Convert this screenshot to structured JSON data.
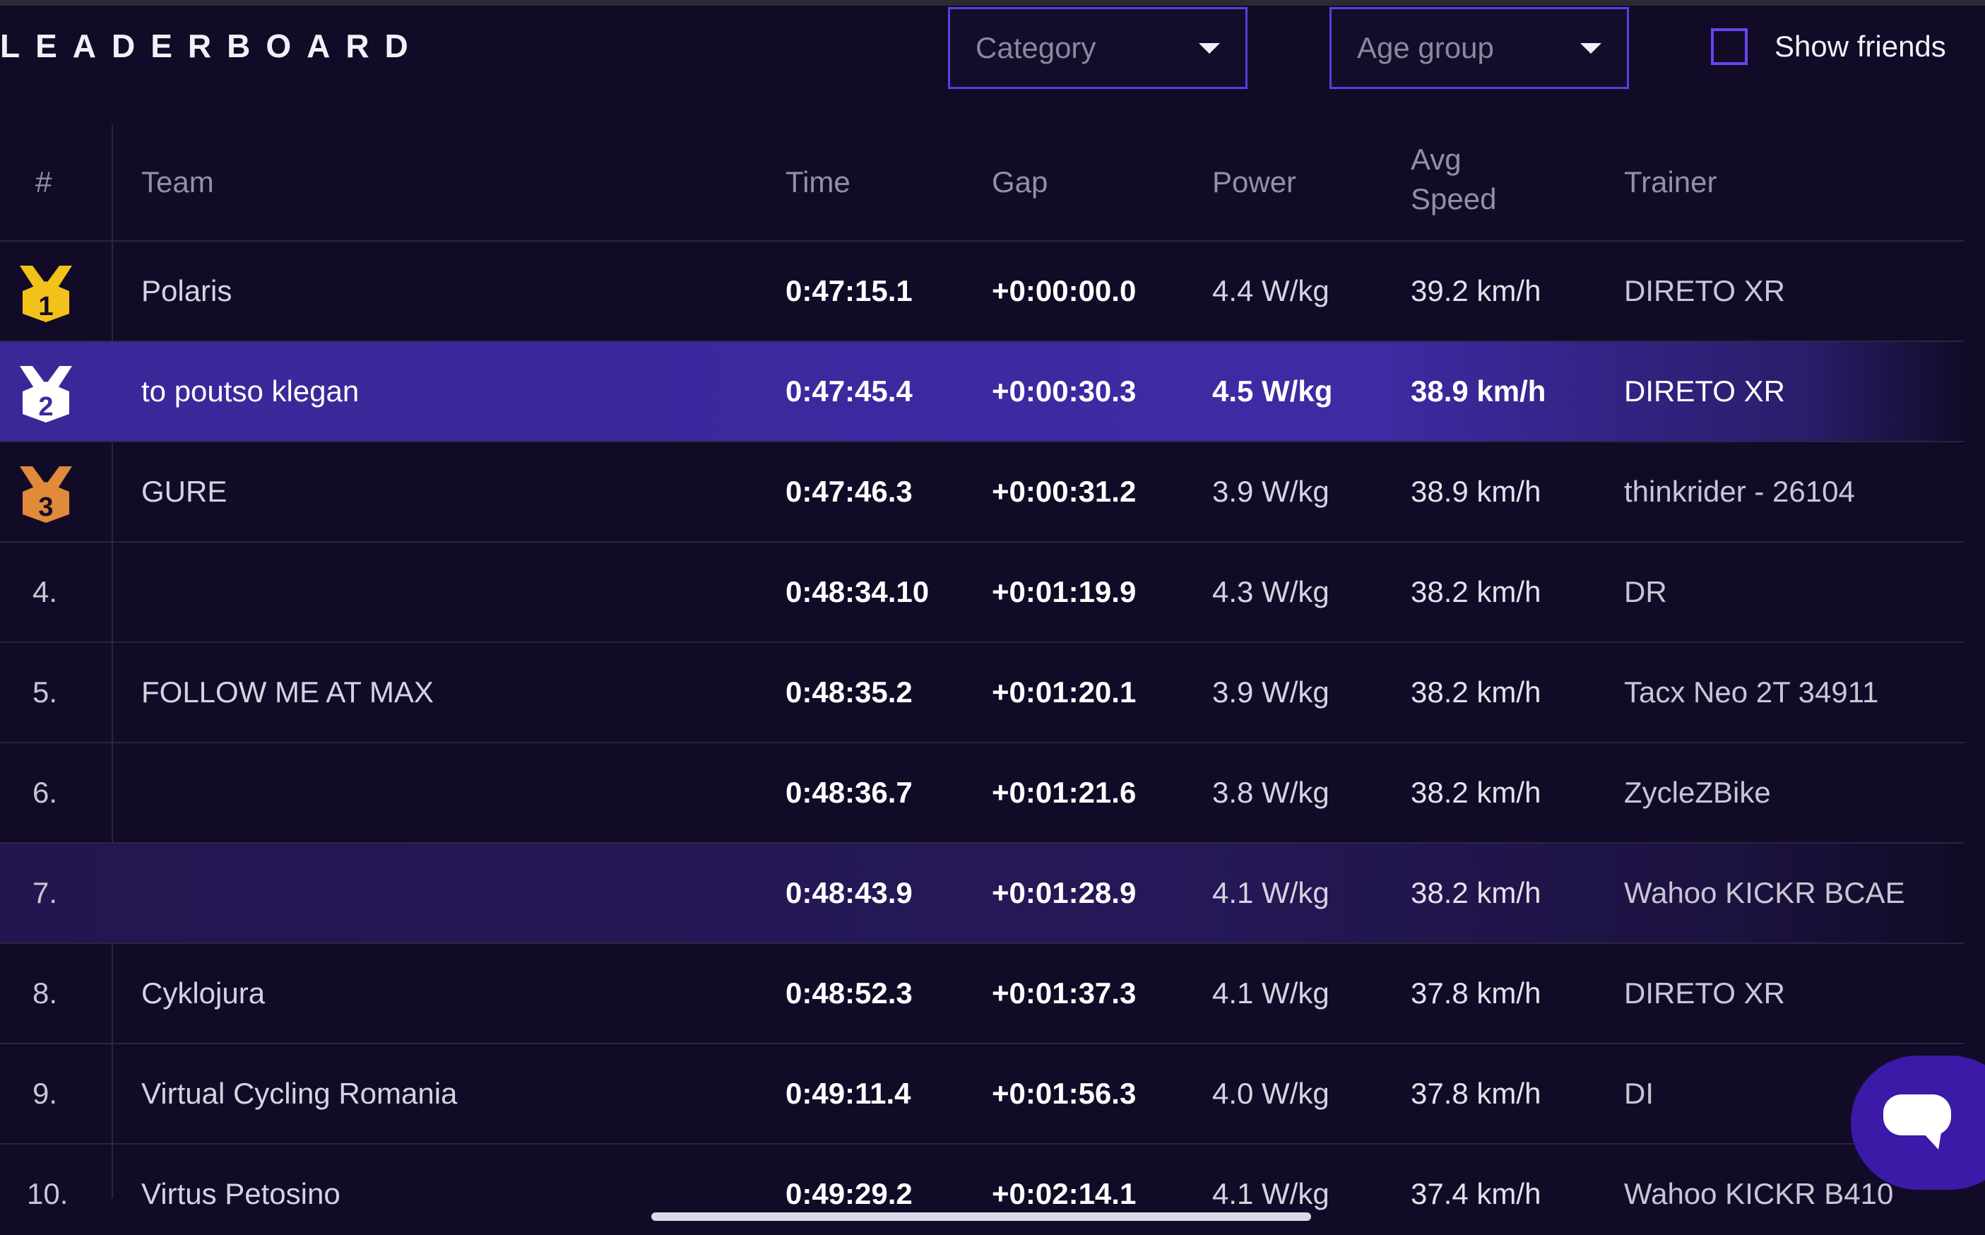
{
  "header": {
    "title": "LEADERBOARD",
    "category": {
      "placeholder": "Category"
    },
    "age_group": {
      "placeholder": "Age group"
    },
    "show_friends": {
      "label": "Show friends",
      "checked": false
    }
  },
  "table": {
    "columns": {
      "rank": "#",
      "team": "Team",
      "time": "Time",
      "gap": "Gap",
      "power": "Power",
      "avg_speed_line1": "Avg",
      "avg_speed_line2": "Speed",
      "trainer": "Trainer"
    },
    "rows": [
      {
        "rank": "1",
        "team": "Polaris",
        "time": "0:47:15.1",
        "gap": "+0:00:00.0",
        "power": "4.4 W/kg",
        "speed": "39.2 km/h",
        "trainer": "DIRETO XR",
        "medal": "gold"
      },
      {
        "rank": "2",
        "team": "to poutso klegan",
        "time": "0:47:45.4",
        "gap": "+0:00:30.3",
        "power": "4.5 W/kg",
        "speed": "38.9 km/h",
        "trainer": "DIRETO XR",
        "medal": "silver"
      },
      {
        "rank": "3",
        "team": "GURE",
        "time": "0:47:46.3",
        "gap": "+0:00:31.2",
        "power": "3.9 W/kg",
        "speed": "38.9 km/h",
        "trainer": "thinkrider - 26104",
        "medal": "bronze"
      },
      {
        "rank": "4.",
        "team": "",
        "time": "0:48:34.10",
        "gap": "+0:01:19.9",
        "power": "4.3 W/kg",
        "speed": "38.2 km/h",
        "trainer": "DR"
      },
      {
        "rank": "5.",
        "team": "FOLLOW ME AT MAX",
        "time": "0:48:35.2",
        "gap": "+0:01:20.1",
        "power": "3.9 W/kg",
        "speed": "38.2 km/h",
        "trainer": "Tacx Neo 2T 34911"
      },
      {
        "rank": "6.",
        "team": "",
        "time": "0:48:36.7",
        "gap": "+0:01:21.6",
        "power": "3.8 W/kg",
        "speed": "38.2 km/h",
        "trainer": "ZycleZBike"
      },
      {
        "rank": "7.",
        "team": "",
        "time": "0:48:43.9",
        "gap": "+0:01:28.9",
        "power": "4.1 W/kg",
        "speed": "38.2 km/h",
        "trainer": "Wahoo KICKR BCAE"
      },
      {
        "rank": "8.",
        "team": "Cyklojura",
        "time": "0:48:52.3",
        "gap": "+0:01:37.3",
        "power": "4.1 W/kg",
        "speed": "37.8 km/h",
        "trainer": "DIRETO XR"
      },
      {
        "rank": "9.",
        "team": "Virtual Cycling Romania",
        "time": "0:49:11.4",
        "gap": "+0:01:56.3",
        "power": "4.0 W/kg",
        "speed": "37.8 km/h",
        "trainer": "DI"
      },
      {
        "rank": "10.",
        "team": "Virtus Petosino",
        "time": "0:49:29.2",
        "gap": "+0:02:14.1",
        "power": "4.1 W/kg",
        "speed": "37.4 km/h",
        "trainer": "Wahoo KICKR B410"
      }
    ]
  },
  "icons": {
    "medal_gold": "medal-gold-icon",
    "medal_silver": "medal-silver-icon",
    "medal_bronze": "medal-bronze-icon",
    "chat": "chat-bubble-icon",
    "caret": "caret-down-icon"
  },
  "colors": {
    "background": "#120b27",
    "accent": "#5a3ee0",
    "highlight_row": "#3f2aa3",
    "gold": "#f2c21b",
    "silver": "#ffffff",
    "bronze": "#e08a3a",
    "chat_button": "#3a1aa6"
  }
}
